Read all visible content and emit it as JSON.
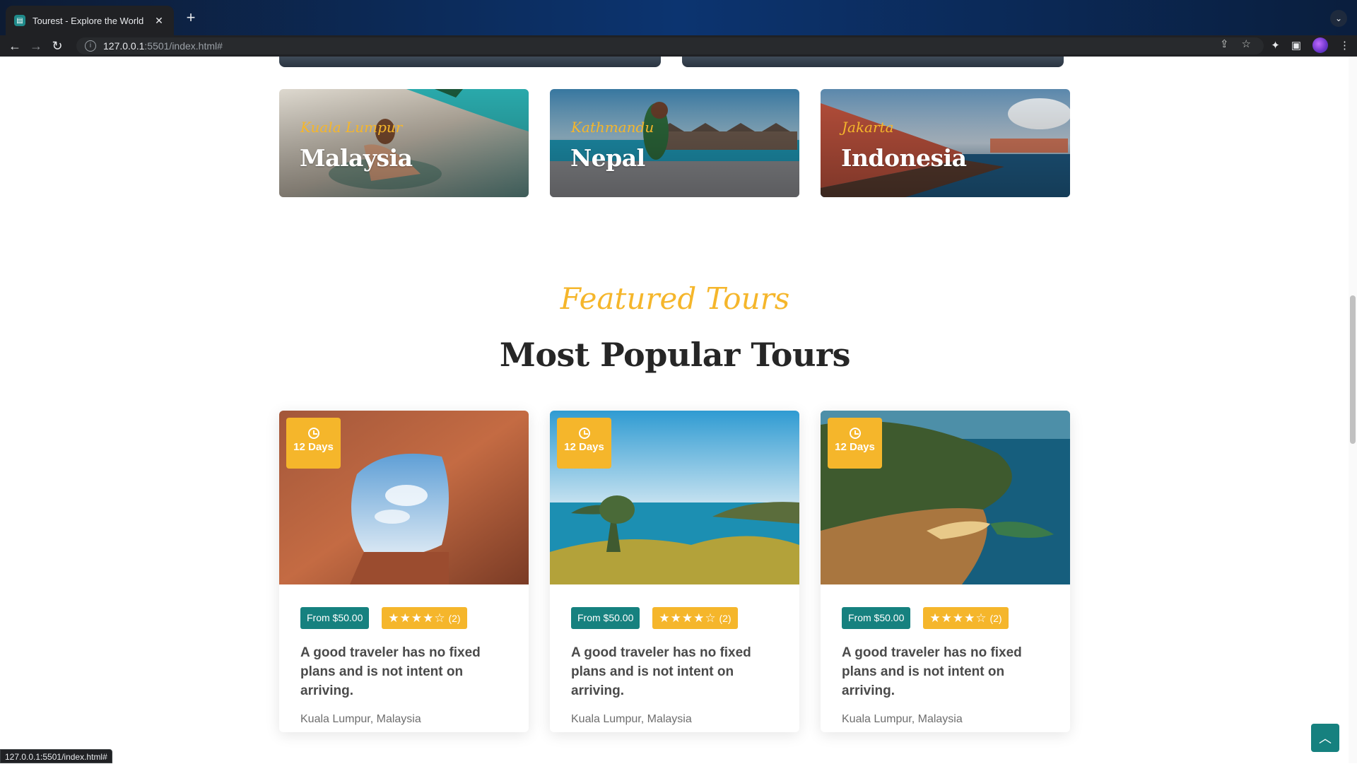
{
  "browser": {
    "tab_title": "Tourest - Explore the World",
    "url_host": "127.0.0.1",
    "url_path": ":5501/index.html#",
    "status_url": "127.0.0.1:5501/index.html#"
  },
  "destinations": [
    {
      "subtitle": "Kuala Lumpur",
      "name": "Malaysia"
    },
    {
      "subtitle": "Kathmandu",
      "name": "Nepal"
    },
    {
      "subtitle": "Jakarta",
      "name": "Indonesia"
    }
  ],
  "featured": {
    "subtitle": "Featured Tours",
    "title": "Most Popular Tours"
  },
  "tours": [
    {
      "days": "12 Days",
      "price": "From $50.00",
      "stars": "★★★★☆",
      "rating_count": "(2)",
      "title": "A good traveler has no fixed plans and is not intent on arriving.",
      "location": "Kuala Lumpur, Malaysia",
      "rating_value": 4
    },
    {
      "days": "12 Days",
      "price": "From $50.00",
      "stars": "★★★★☆",
      "rating_count": "(2)",
      "title": "A good traveler has no fixed plans and is not intent on arriving.",
      "location": "Kuala Lumpur, Malaysia",
      "rating_value": 4
    },
    {
      "days": "12 Days",
      "price": "From $50.00",
      "stars": "★★★★☆",
      "rating_count": "(2)",
      "title": "A good traveler has no fixed plans and is not intent on arriving.",
      "location": "Kuala Lumpur, Malaysia",
      "rating_value": 4
    }
  ],
  "colors": {
    "accent_yellow": "#f5b62b",
    "accent_teal": "#16817f",
    "heading": "#262626"
  }
}
